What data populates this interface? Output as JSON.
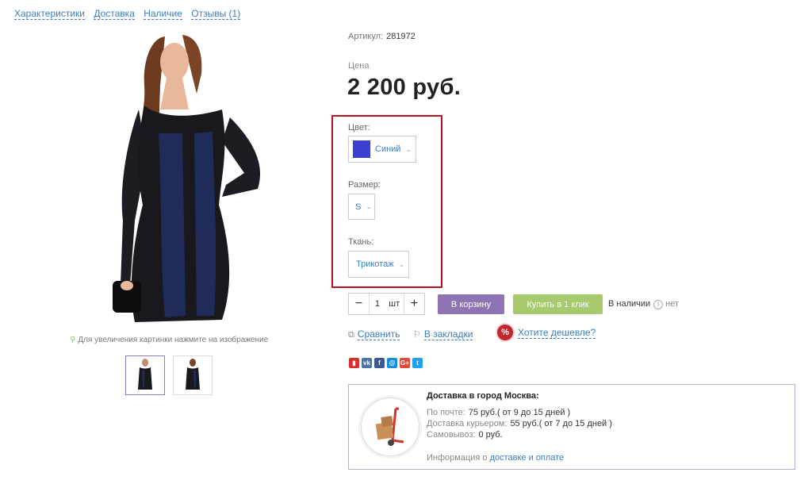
{
  "nav": {
    "items": [
      "Характеристики",
      "Доставка",
      "Наличие",
      "Отзывы (1)"
    ]
  },
  "gallery": {
    "zoom_hint": "Для увеличения картинки нажмите на изображение"
  },
  "product": {
    "article_label": "Артикул:",
    "article_value": "281972",
    "price_label": "Цена",
    "price": "2 200 руб."
  },
  "options": {
    "color_label": "Цвет:",
    "color_value": "Синий",
    "color_swatch": "#3c3fcf",
    "size_label": "Размер:",
    "size_value": "S",
    "fabric_label": "Ткань:",
    "fabric_value": "Трикотаж"
  },
  "purchase": {
    "qty_value": "1",
    "qty_unit": "шт",
    "cart_label": "В корзину",
    "oneclick_label": "Купить в 1 клик",
    "availability_label": "В наличии",
    "availability_value": "нет"
  },
  "actions": {
    "compare": "Сравнить",
    "bookmark": "В закладки",
    "cheaper_badge": "%",
    "cheaper": "Хотите дешевле?"
  },
  "social": [
    {
      "icon": "bookmark-icon",
      "glyph": "▮",
      "color": "#d9302c"
    },
    {
      "icon": "vk-icon",
      "glyph": "vk",
      "color": "#4c75a3"
    },
    {
      "icon": "facebook-icon",
      "glyph": "f",
      "color": "#3b5998"
    },
    {
      "icon": "moimir-icon",
      "glyph": "@",
      "color": "#168de2"
    },
    {
      "icon": "googleplus-icon",
      "glyph": "G+",
      "color": "#dd4b39"
    },
    {
      "icon": "twitter-icon",
      "glyph": "t",
      "color": "#1da1f2"
    }
  ],
  "delivery": {
    "title": "Доставка в город Москва:",
    "post_label": "По почте:",
    "post_value": "75 руб.( от 9 до 15 дней )",
    "courier_label": "Доставка курьером:",
    "courier_value": "55 руб.( от 7 до 15 дней )",
    "pickup_label": "Самовывоз:",
    "pickup_value": "0 руб.",
    "info_prefix": "Информация о",
    "info_link": "доставке и оплате"
  },
  "colors": {
    "accent_link": "#3a7ec2",
    "highlight_box": "#b5121b",
    "cart_button": "#8e74b4",
    "oneclick_button": "#a7ca6e"
  }
}
